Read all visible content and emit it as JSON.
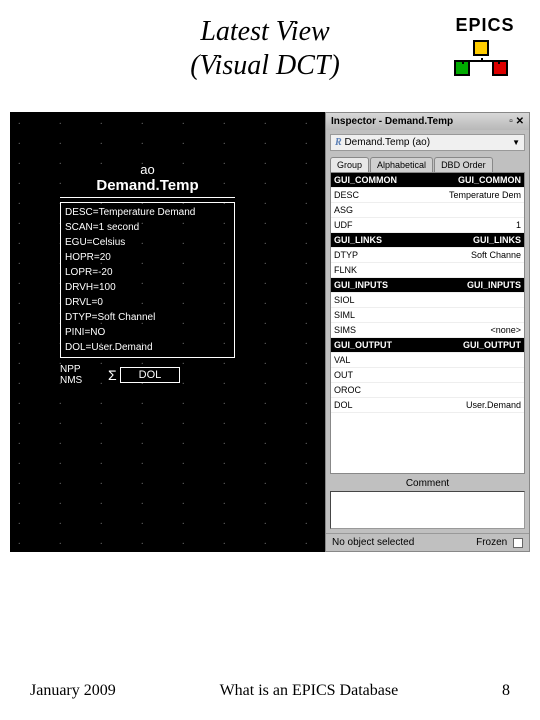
{
  "header": {
    "title_line1": "Latest View",
    "title_line2": "(Visual DCT)",
    "logo_text": "EPICS"
  },
  "record": {
    "type": "ao",
    "name": "Demand.Temp",
    "fields": [
      "DESC=Temperature Demand",
      "SCAN=1 second",
      "EGU=Celsius",
      "HOPR=20",
      "LOPR=-20",
      "DRVH=100",
      "DRVL=0",
      "DTYP=Soft Channel",
      "PINI=NO",
      "DOL=User.Demand"
    ],
    "dol_left": "NPP NMS",
    "dol_label": "DOL"
  },
  "inspector": {
    "title_prefix": "Inspector -",
    "title_obj": "Demand.Temp",
    "dropdown": "Demand.Temp (ao)",
    "tabs": [
      "Group",
      "Alphabetical",
      "DBD Order"
    ],
    "rows": [
      {
        "type": "hdr",
        "k": "GUI_COMMON",
        "v": "GUI_COMMON"
      },
      {
        "type": "row",
        "k": "DESC",
        "v": "Temperature Dem"
      },
      {
        "type": "row",
        "k": "ASG",
        "v": ""
      },
      {
        "type": "row",
        "k": "UDF",
        "v": "1"
      },
      {
        "type": "hdr",
        "k": "GUI_LINKS",
        "v": "GUI_LINKS"
      },
      {
        "type": "row",
        "k": "DTYP",
        "v": "Soft Channe"
      },
      {
        "type": "row",
        "k": "FLNK",
        "v": ""
      },
      {
        "type": "hdr",
        "k": "GUI_INPUTS",
        "v": "GUI_INPUTS"
      },
      {
        "type": "row",
        "k": "SIOL",
        "v": ""
      },
      {
        "type": "row",
        "k": "SIML",
        "v": ""
      },
      {
        "type": "row",
        "k": "SIMS",
        "v": "<none>"
      },
      {
        "type": "hdr",
        "k": "GUI_OUTPUT",
        "v": "GUI_OUTPUT"
      },
      {
        "type": "row",
        "k": "VAL",
        "v": ""
      },
      {
        "type": "row",
        "k": "OUT",
        "v": ""
      },
      {
        "type": "row",
        "k": "OROC",
        "v": ""
      },
      {
        "type": "row",
        "k": "DOL",
        "v": "User.Demand"
      }
    ],
    "comment_label": "Comment",
    "status_left": "No object selected",
    "status_right": "Frozen"
  },
  "footer": {
    "date": "January 2009",
    "caption": "What is an EPICS Database",
    "page": "8"
  }
}
